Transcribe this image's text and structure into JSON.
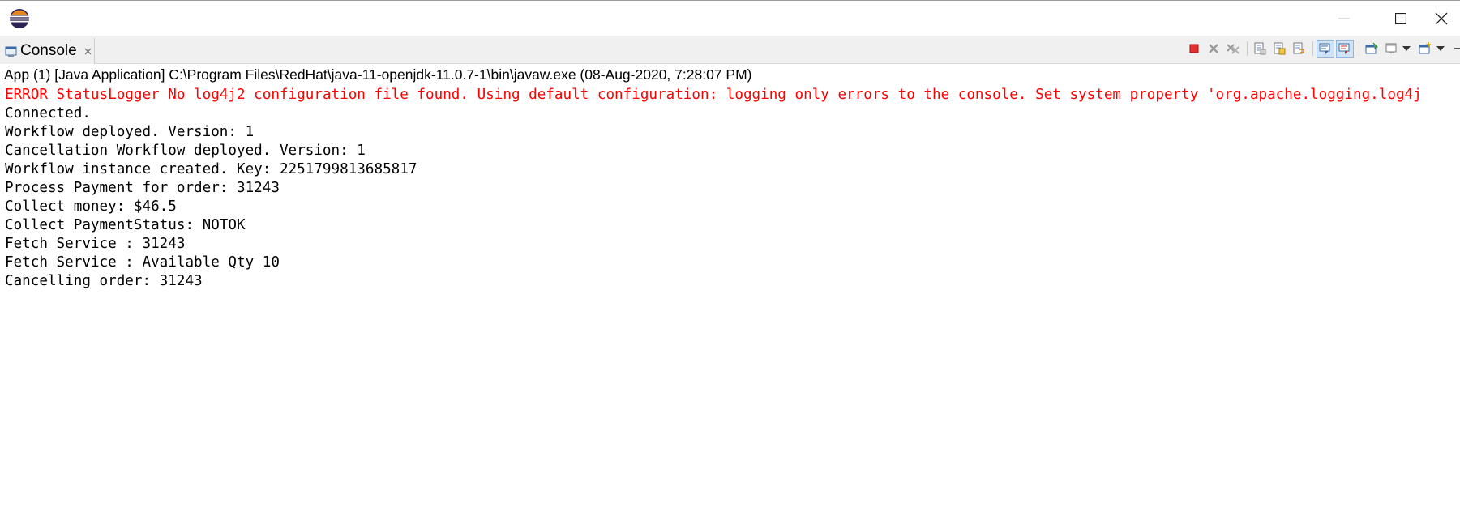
{
  "window": {
    "icons": {
      "app": "eclipse-icon",
      "minimize": "minimize-icon",
      "maximize": "maximize-icon",
      "close": "close-icon"
    }
  },
  "tab": {
    "label": "Console",
    "icon": "console-icon",
    "close_icon": "tab-close-icon"
  },
  "toolbar": {
    "buttons": [
      "terminate-icon",
      "remove-launch-icon",
      "remove-all-terminated-icon",
      "clear-console-icon",
      "scroll-lock-icon",
      "word-wrap-icon",
      "show-on-stdout-icon",
      "show-on-stderr-icon",
      "pin-console-icon",
      "display-selected-console-icon",
      "display-dropdown-icon",
      "open-console-icon",
      "open-console-dropdown-icon",
      "view-menu-icon"
    ]
  },
  "process": {
    "label": "App (1) [Java Application] C:\\Program Files\\RedHat\\java-11-openjdk-11.0.7-1\\bin\\javaw.exe  (08-Aug-2020, 7:28:07 PM)"
  },
  "console": {
    "error_color": "#ff0000",
    "lines": [
      {
        "text": "ERROR StatusLogger No log4j2 configuration file found. Using default configuration: logging only errors to the console. Set system property 'org.apache.logging.log4j",
        "error": true
      },
      {
        "text": "Connected.",
        "error": false
      },
      {
        "text": "Workflow deployed. Version: 1",
        "error": false
      },
      {
        "text": "Cancellation Workflow deployed. Version: 1",
        "error": false
      },
      {
        "text": "Workflow instance created. Key: 2251799813685817",
        "error": false
      },
      {
        "text": "Process Payment for order: 31243",
        "error": false
      },
      {
        "text": "Collect money: $46.5",
        "error": false
      },
      {
        "text": "Collect PaymentStatus: NOTOK",
        "error": false
      },
      {
        "text": "Fetch Service : 31243",
        "error": false
      },
      {
        "text": "Fetch Service : Available Qty 10",
        "error": false
      },
      {
        "text": "Cancelling order: 31243",
        "error": false
      }
    ]
  }
}
